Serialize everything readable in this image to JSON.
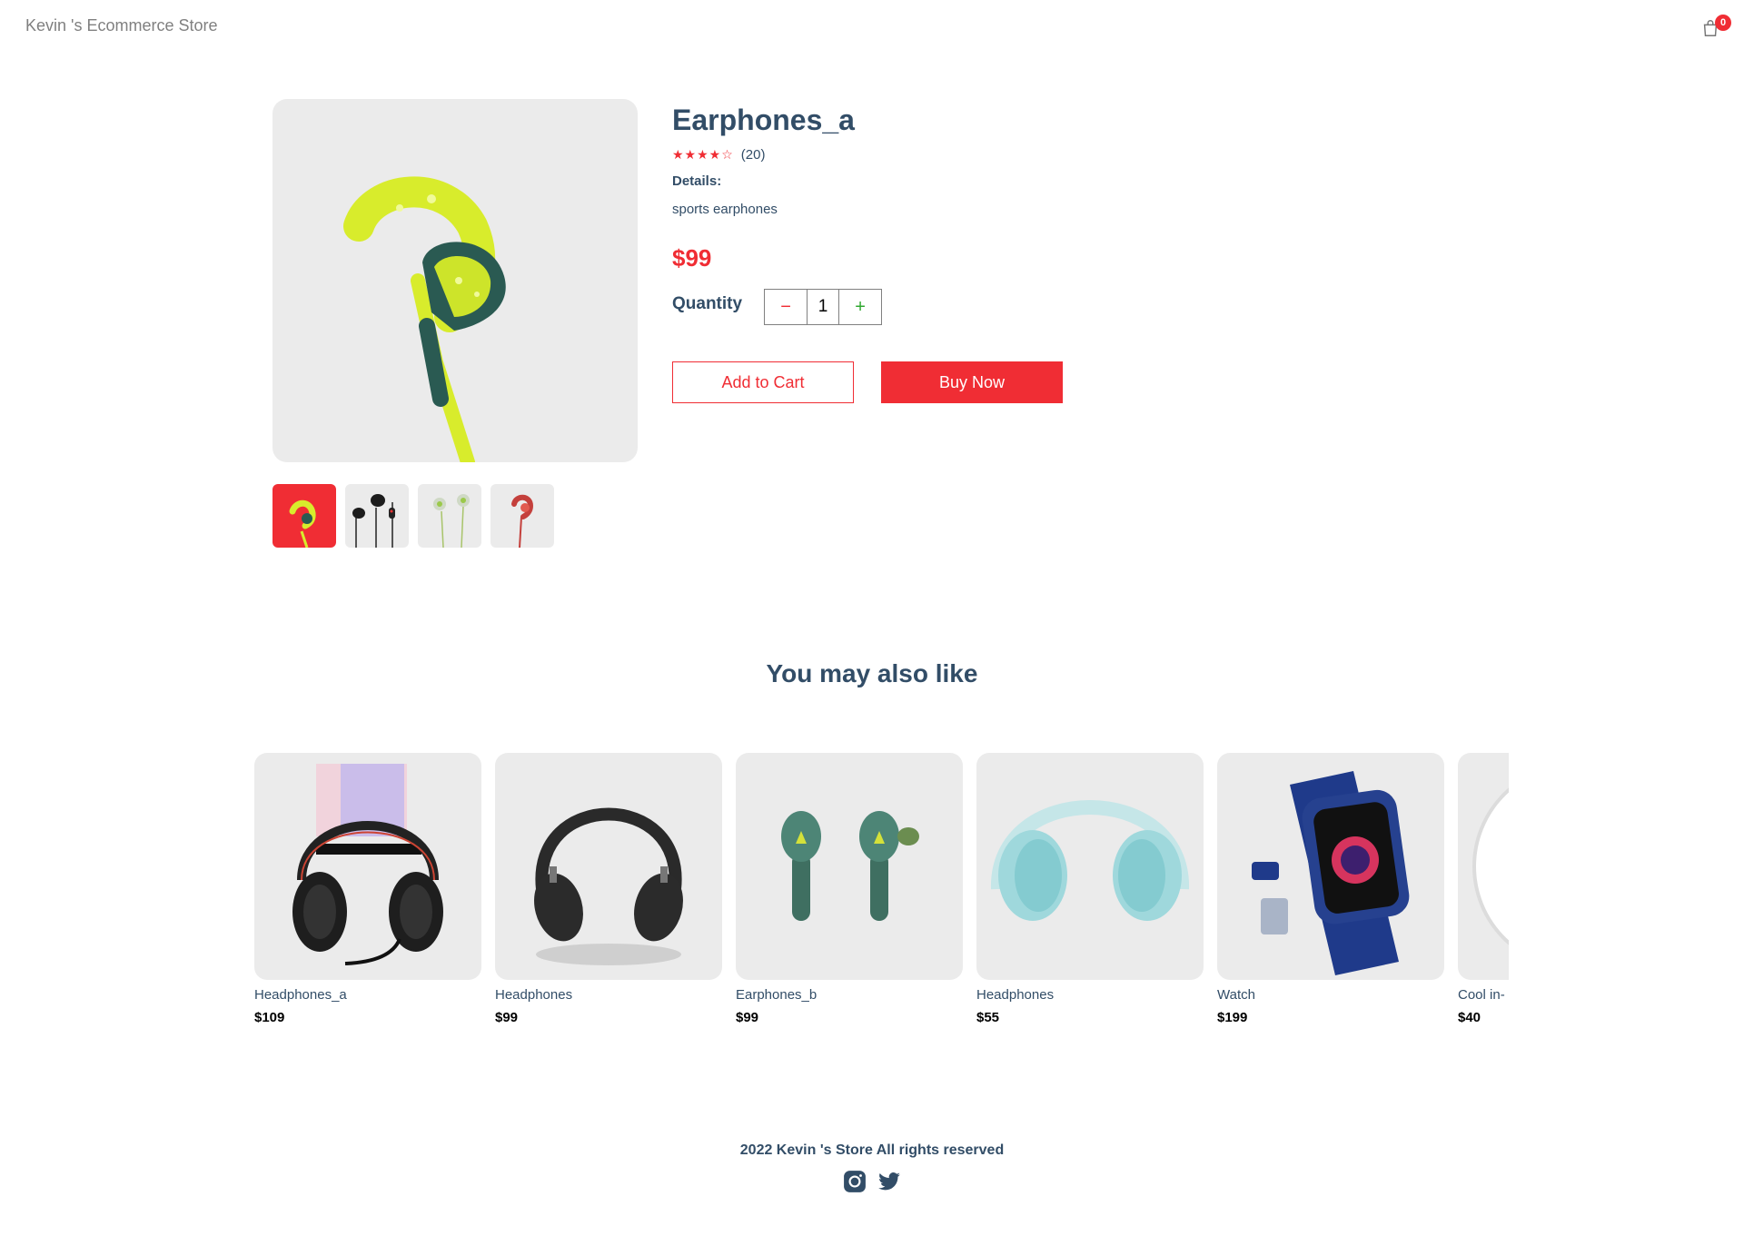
{
  "navbar": {
    "logo": "Kevin 's Ecommerce Store",
    "cart_count": "0"
  },
  "product": {
    "name": "Earphones_a",
    "rating_stars": "★★★★☆",
    "review_count": "(20)",
    "details_title": "Details:",
    "details": "sports earphones",
    "price": "$99",
    "quantity_label": "Quantity",
    "quantity": "1",
    "minus_symbol": "−",
    "plus_symbol": "+",
    "add_to_cart": "Add to Cart",
    "buy_now": "Buy Now"
  },
  "thumbnails": [
    {
      "icon": "yellow-earphone",
      "selected": true
    },
    {
      "icon": "black-earphones",
      "selected": false
    },
    {
      "icon": "green-earphones",
      "selected": false
    },
    {
      "icon": "red-earphone",
      "selected": false
    }
  ],
  "maylike": {
    "title": "You may also like",
    "products": [
      {
        "name": "Headphones_a",
        "price": "$109",
        "icon": "gaming-headphones"
      },
      {
        "name": "Headphones",
        "price": "$99",
        "icon": "black-headphones"
      },
      {
        "name": "Earphones_b",
        "price": "$99",
        "icon": "green-earbuds"
      },
      {
        "name": "Headphones",
        "price": "$55",
        "icon": "mint-headphones"
      },
      {
        "name": "Watch",
        "price": "$199",
        "icon": "smart-watch"
      },
      {
        "name": "Cool in-",
        "price": "$40",
        "icon": "speaker"
      }
    ]
  },
  "footer": {
    "text": "2022 Kevin 's Store All rights reserved",
    "icons": [
      "instagram-icon",
      "twitter-icon"
    ]
  },
  "colors": {
    "accent": "#f02d34",
    "text": "#324d67",
    "image_bg": "#ebebeb",
    "plus": "#31a831"
  }
}
